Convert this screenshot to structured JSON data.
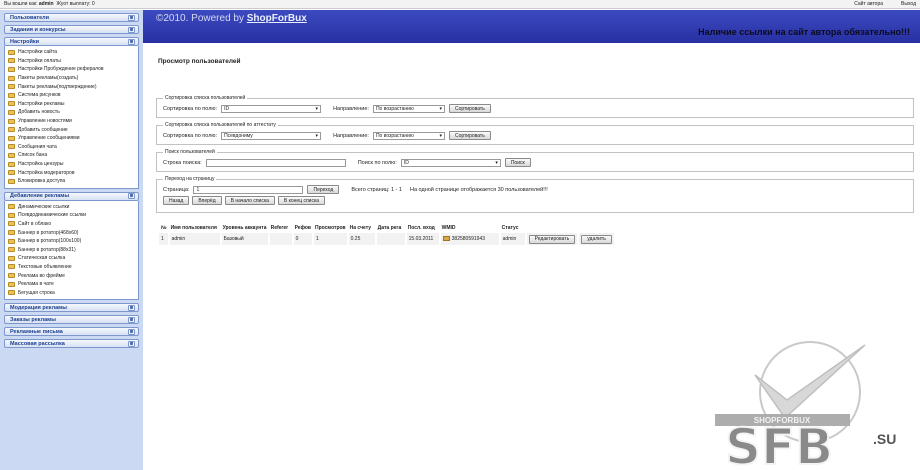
{
  "topbar": {
    "left_text": "Вы вошли как:",
    "user": "admin",
    "balance": "Жуот выплату: 0",
    "right_links": [
      "Сайт автора",
      "Выход"
    ]
  },
  "header": {
    "title": "©2010. Powered by",
    "brand": "ShopForBux",
    "notice": "Наличие ссылки на сайт автора обязательно!!!"
  },
  "sidebar": {
    "sections": [
      {
        "title": "Пользователи",
        "items": []
      },
      {
        "title": "Задания и конкурсы",
        "items": []
      },
      {
        "title": "Настройки",
        "items": [
          "Настройки сайта",
          "Настройки оплаты",
          "Настройки Пробуждение рефералов",
          "Пакеты рекламы(создать)",
          "Пакеты рекламы(подтверждение)",
          "Система рисунков",
          "Настройки рекламы",
          "Добавить новость",
          "Управление новостями",
          "Добавить сообщение",
          "Управление сообщениями",
          "Сообщения чата",
          "Список бана",
          "Настройка цензуры",
          "Настройка модераторов",
          "Блокировка доступа"
        ]
      },
      {
        "title": "Дебавление рекламы",
        "items": [
          "Динамические ссылки",
          "Псевдодинамические ссылки",
          "Сайт в облако",
          "Баннер в ротатор(468x60)",
          "Баннер в ротатор(100x100)",
          "Баннер в ротатор(88x31)",
          "Статическая ссылка",
          "Текстовые объявление",
          "Реклама во фрейме",
          "Реклама в чате",
          "Бегущая строка"
        ]
      },
      {
        "title": "Модерация рекламы",
        "items": []
      },
      {
        "title": "Заказы рекламы",
        "items": []
      },
      {
        "title": "Рекламные письма",
        "items": []
      },
      {
        "title": "Массовая рассылка",
        "items": []
      }
    ],
    "toggle": "⊞"
  },
  "page": {
    "title": "Просмотр пользователей"
  },
  "sort1": {
    "legend": "Сортировка списка пользователей",
    "field_label": "Сортировка по полю:",
    "field_value": "ID",
    "dir_label": "Направление:",
    "dir_value": "По возрастанию",
    "button": "Сортировать"
  },
  "sort2": {
    "legend": "Сортировка списка пользователей по аттестату",
    "field_label": "Сортировка по полю:",
    "field_value": "Псевдониму",
    "dir_label": "Направление:",
    "dir_value": "По возрастанию",
    "button": "Сортировать"
  },
  "search": {
    "legend": "Поиск пользователей",
    "query_label": "Строка поиска:",
    "query_value": "",
    "field_label": "Поиск по полю:",
    "field_value": "ID",
    "button": "Поиск"
  },
  "paging": {
    "legend": "Переход на страницу",
    "page_label": "Страница:",
    "page_value": "1",
    "goto_button": "Переход",
    "pages_info": "Всего страниц: 1 - 1",
    "per_page_info": "На одной странице отображается 30 пользователей!!!",
    "buttons": [
      "Назад",
      "Вперёд",
      "В начало списка",
      "В конец списка"
    ]
  },
  "table": {
    "headers": [
      "№",
      "Имя пользователя",
      "Уровень аккаунта",
      "Referer",
      "Рефов",
      "Просмотров",
      "На счету",
      "Дата рега",
      "Посл. вход",
      "WMID",
      "",
      "Статус",
      "",
      ""
    ],
    "rows": [
      {
        "num": "1",
        "name": "admin",
        "level": "Базовый",
        "referer": "",
        "refs": "0",
        "views": "1",
        "balance": "0.25",
        "reg_date": "",
        "last_login": "15.03.2011",
        "wmid": "382580591943",
        "status": "admin",
        "edit": "Редактировать",
        "delete": "удалить"
      }
    ]
  },
  "watermark": {
    "text": "SFB",
    "suffix": ".SU",
    "band_text": "SHOPFORBUX"
  }
}
